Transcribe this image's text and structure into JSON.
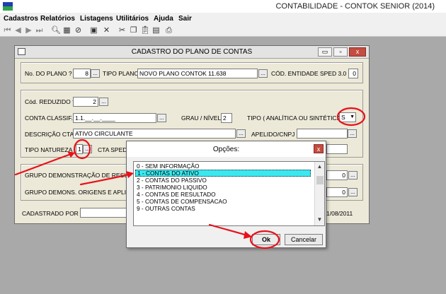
{
  "app": {
    "title": "CONTABILIDADE - CONTOK SENIOR (2014)"
  },
  "menu": [
    "Cadastros",
    "Relatórios",
    "Listagens",
    "Utilitários",
    "Ajuda",
    "Sair"
  ],
  "toolbar": {
    "icons": [
      "first-icon",
      "prev-icon",
      "next-icon",
      "last-icon",
      "find-icon",
      "grid-icon",
      "no-icon",
      "save-icon",
      "delete-icon",
      "cut-icon",
      "copy-icon",
      "paste-icon",
      "screen-icon",
      "print-icon"
    ]
  },
  "window": {
    "title": "CADASTRO DO PLANO DE CONTAS",
    "controls": {
      "minimize": "▭",
      "restore": "▫",
      "close": "x"
    }
  },
  "form": {
    "no_plano_label": "No. DO PLANO ?",
    "no_plano_value": "8",
    "tipo_plano_label": "TIPO PLANO",
    "tipo_plano_value": "NOVO PLANO CONTOK 11.638",
    "cod_sped_label": "CÓD. ENTIDADE SPED 3.0",
    "cod_sped_value": "0",
    "cod_reduzido_label": "Cód. REDUZIDO ?",
    "cod_reduzido_value": "2",
    "conta_classif_label": "CONTA  CLASSIF.",
    "conta_classif_value": "1.1.__.__.____",
    "grau_nivel_label": "GRAU / NÍVEL",
    "grau_nivel_value": "2",
    "tipo_analitica_label": "TIPO ( ANALÍTICA OU SINTÉTICA )",
    "tipo_analitica_value": "S",
    "descricao_label": "DESCRIÇÃO CTA.",
    "descricao_value": "ATIVO CIRCULANTE",
    "apelido_label": "APELIDO/CNPJ",
    "apelido_value": "",
    "tipo_natureza_label": "TIPO  NATUREZA",
    "tipo_natureza_value": "1",
    "cta_sped_label": "CTA SPED",
    "grupo_demo_label": "GRUPO DEMONSTRAÇÃO DE RESULT",
    "grupo_demo_value": "0",
    "grupo_origens_label": "GRUPO DEMONS. ORIGENS  E  APLICA",
    "grupo_origens_value": "0",
    "cadastrado_label": "CADASTRADO POR :",
    "date_value": "1/08/2011",
    "ellipsis": "..."
  },
  "dialog": {
    "title": "Opções:",
    "close": "x",
    "options": [
      "0 - SEM INFORMAÇÃO",
      "1 - CONTAS DO ATIVO",
      "2 - CONTAS DO PASSIVO",
      "3 - PATRIMONIO LIQUIDO",
      "4 - CONTAS DE RESULTADO",
      "5 - CONTAS DE COMPENSACAO",
      "9 - OUTRAS CONTAS"
    ],
    "selected_index": 1,
    "ok_label": "Ok",
    "cancel_label": "Cancelar"
  },
  "annotations": {
    "color": "#e8101a"
  }
}
